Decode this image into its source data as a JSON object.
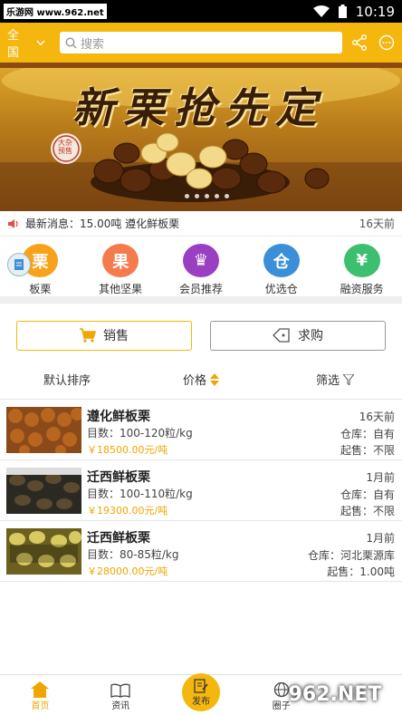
{
  "watermark_top": "乐游网 www.962.net",
  "status": {
    "time": "10:19"
  },
  "header": {
    "region": "全国",
    "search_placeholder": "搜索"
  },
  "banner": {
    "title": "新栗抢先定",
    "badge": "大杂预售"
  },
  "news": {
    "text": "最新消息：15.00吨  遵化鲜板栗",
    "time": "16天前"
  },
  "categories": [
    {
      "label": "板栗",
      "glyph": "栗",
      "color": "#f7a21a"
    },
    {
      "label": "其他坚果",
      "glyph": "果",
      "color": "#f47b4c"
    },
    {
      "label": "会员推荐",
      "glyph": "♛",
      "color": "#9b3fc2"
    },
    {
      "label": "优选仓",
      "glyph": "仓",
      "color": "#3b8fd8"
    },
    {
      "label": "融资服务",
      "glyph": "¥",
      "color": "#3cbf6e"
    }
  ],
  "trade_tabs": {
    "sell": "销售",
    "buy": "求购"
  },
  "sort": {
    "default": "默认排序",
    "price": "价格",
    "filter": "筛选"
  },
  "listings": [
    {
      "title": "遵化鲜板栗",
      "spec": "目数：100-120粒/kg",
      "price": "￥18500.00元/吨",
      "time": "16天前",
      "warehouse": "仓库：自有",
      "min": "起售：不限"
    },
    {
      "title": "迁西鲜板栗",
      "spec": "目数：100-110粒/kg",
      "price": "￥19300.00元/吨",
      "time": "1月前",
      "warehouse": "仓库：自有",
      "min": "起售：不限"
    },
    {
      "title": "迁西鲜板栗",
      "spec": "目数：80-85粒/kg",
      "price": "￥28000.00元/吨",
      "time": "1月前",
      "warehouse": "仓库：河北栗源库",
      "min": "起售：1.00吨"
    }
  ],
  "bottom_nav": {
    "home": "首页",
    "news": "资讯",
    "publish": "发布",
    "circle": "圈子"
  },
  "watermark_bottom": "962.NET"
}
